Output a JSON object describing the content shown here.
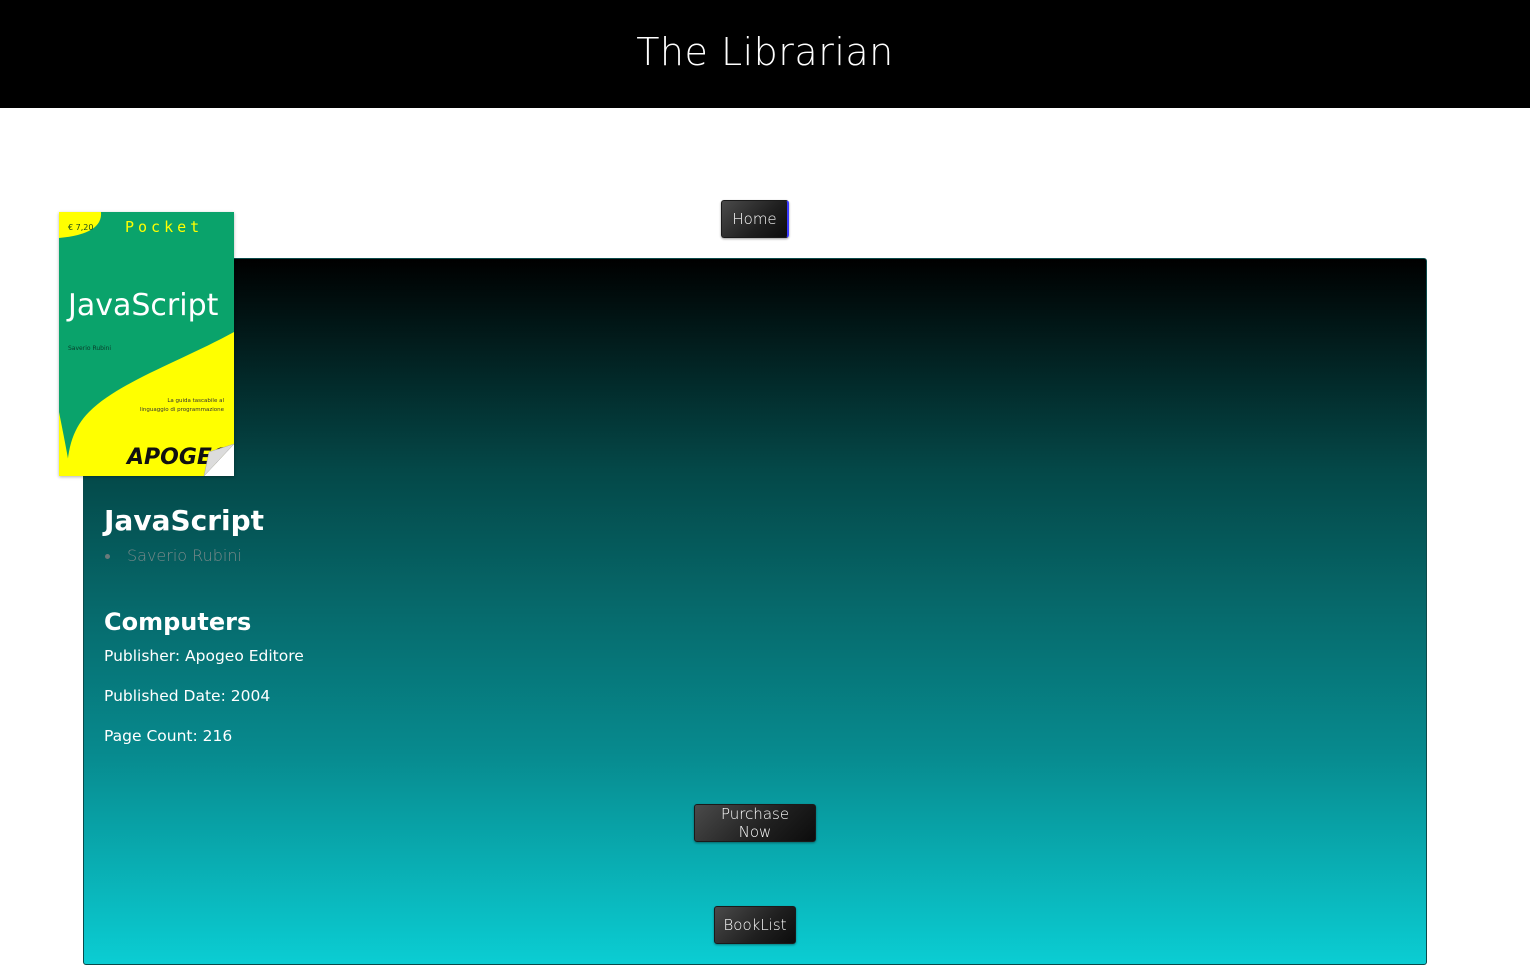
{
  "header": {
    "title": "The Librarian"
  },
  "nav": {
    "home_label": "Home"
  },
  "book": {
    "cover": {
      "price": "€ 7,20",
      "series": "Pocket",
      "title": "JavaScript",
      "author": "Saverio Rubini",
      "tagline_line1": "La guida tascabile al",
      "tagline_line2": "linguaggio di programmazione",
      "publisher_logo": "APOGEO",
      "colors": {
        "green": "#0aa36b",
        "yellow": "#ffff00"
      }
    },
    "title": "JavaScript",
    "authors": [
      "Saverio Rubini"
    ],
    "category": "Computers",
    "publisher": "Publisher: Apogeo Editore",
    "published_date": "Published Date: 2004",
    "page_count": "Page Count: 216"
  },
  "actions": {
    "purchase_label": "Purchase Now",
    "booklist_label": "BookList"
  }
}
